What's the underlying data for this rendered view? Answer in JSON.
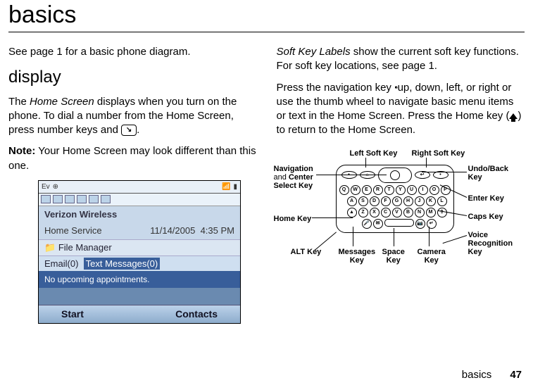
{
  "page": {
    "title": "basics",
    "footer_label": "basics",
    "page_number": "47"
  },
  "left_col": {
    "see_page": "See page 1 for a basic phone diagram.",
    "subheading": "display",
    "para1_pre": "The ",
    "para1_ital": "Home Screen",
    "para1_post": " displays when you turn on the phone. To dial a number from the Home Screen, press number keys and ",
    "para1_end": ".",
    "para2_bold": "Note:",
    "para2_rest": " Your Home Screen may look different than this one."
  },
  "right_col": {
    "para1_ital": "Soft Key Labels",
    "para1_rest": " show the current soft key functions. For soft key locations, see page 1.",
    "para2_a": "Press the navigation key ",
    "para2_b": " up, down, left, or right or use the thumb wheel to navigate basic menu items or text in the Home Screen. Press the Home key (",
    "para2_c": ") to return to the Home Screen."
  },
  "screenshot": {
    "status_ev": "Ev",
    "carrier": "Verizon Wireless",
    "service_line": "Home Service",
    "date": "11/14/2005",
    "time": "4:35 PM",
    "folder": "File Manager",
    "email_lead": "Email(0)",
    "text_msgs": "Text Messages(0)",
    "no_appts": "No upcoming appointments.",
    "soft_left": "Start",
    "soft_right": "Contacts"
  },
  "diagram": {
    "left_soft": "Left Soft Key",
    "right_soft": "Right Soft Key",
    "nav1": "Navigation",
    "nav2": "and",
    "nav3": "Center",
    "nav4": "Select Key",
    "undo1": "Undo/Back",
    "undo2": "Key",
    "enter": "Enter Key",
    "caps": "Caps Key",
    "voice1": "Voice",
    "voice2": "Recognition",
    "voice3": "Key",
    "home": "Home Key",
    "alt": "ALT Key",
    "messages1": "Messages",
    "messages2": "Key",
    "space1": "Space",
    "space2": "Key",
    "camera1": "Camera",
    "camera2": "Key"
  },
  "icons": {
    "send_key": "↘",
    "nav_glyph": "·◦·"
  }
}
